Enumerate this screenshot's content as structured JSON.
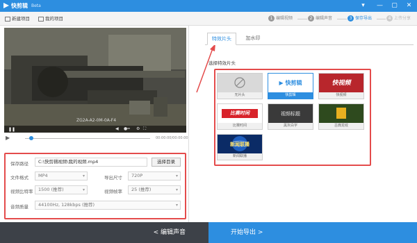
{
  "titlebar": {
    "app_name": "快剪辑",
    "beta": "Beta",
    "controls": [
      "▾",
      "—",
      "▢",
      "✕"
    ]
  },
  "toolbar": {
    "new_project": "新建项目",
    "my_projects": "我的项目",
    "steps": [
      {
        "num": "1",
        "label": "编辑视频"
      },
      {
        "num": "2",
        "label": "编辑声音"
      },
      {
        "num": "3",
        "label": "保存导出"
      },
      {
        "num": "4",
        "label": "上传分享"
      }
    ]
  },
  "player": {
    "caption": "ZG2A-A2-0M-0A-F4",
    "time": "00:00:00/00:00:00",
    "progress_percent": 5
  },
  "settings": {
    "save_path_label": "保存路径",
    "save_path_value": "C:\\快剪辑视频\\我的视频.mp4",
    "choose_dir": "选择目录",
    "format_label": "文件格式",
    "format_value": "MP4",
    "size_label": "导出尺寸",
    "size_value": "720P",
    "bitrate_label": "视频比特率",
    "bitrate_value": "1500 (推荐)",
    "fps_label": "视频帧率",
    "fps_value": "25 (推荐)",
    "audio_label": "音频质量",
    "audio_value": "44100Hz, 128kbps (推荐)"
  },
  "tabs": {
    "opening": "特效片头",
    "watermark": "加水印"
  },
  "templates_section": {
    "title": "选择特效片头",
    "items": [
      {
        "name": "无片头",
        "thumb_text": ""
      },
      {
        "name": "快剪辑",
        "thumb_text": "▶ 快剪辑"
      },
      {
        "name": "快视频",
        "thumb_text": "快视频"
      },
      {
        "name": "比赛时间",
        "thumb_text": "比赛时间"
      },
      {
        "name": "黑灰白字",
        "thumb_text": "视频标题"
      },
      {
        "name": "古典龙纹",
        "thumb_text": ""
      },
      {
        "name": "新闻联播",
        "thumb_text": "新闻联播"
      }
    ]
  },
  "bottom": {
    "prev": "< 编辑声音",
    "next": "开始导出 >"
  },
  "colors": {
    "accent": "#2d8ee0",
    "highlight": "#e44b4b",
    "bottom_bar": "#3d4148"
  }
}
